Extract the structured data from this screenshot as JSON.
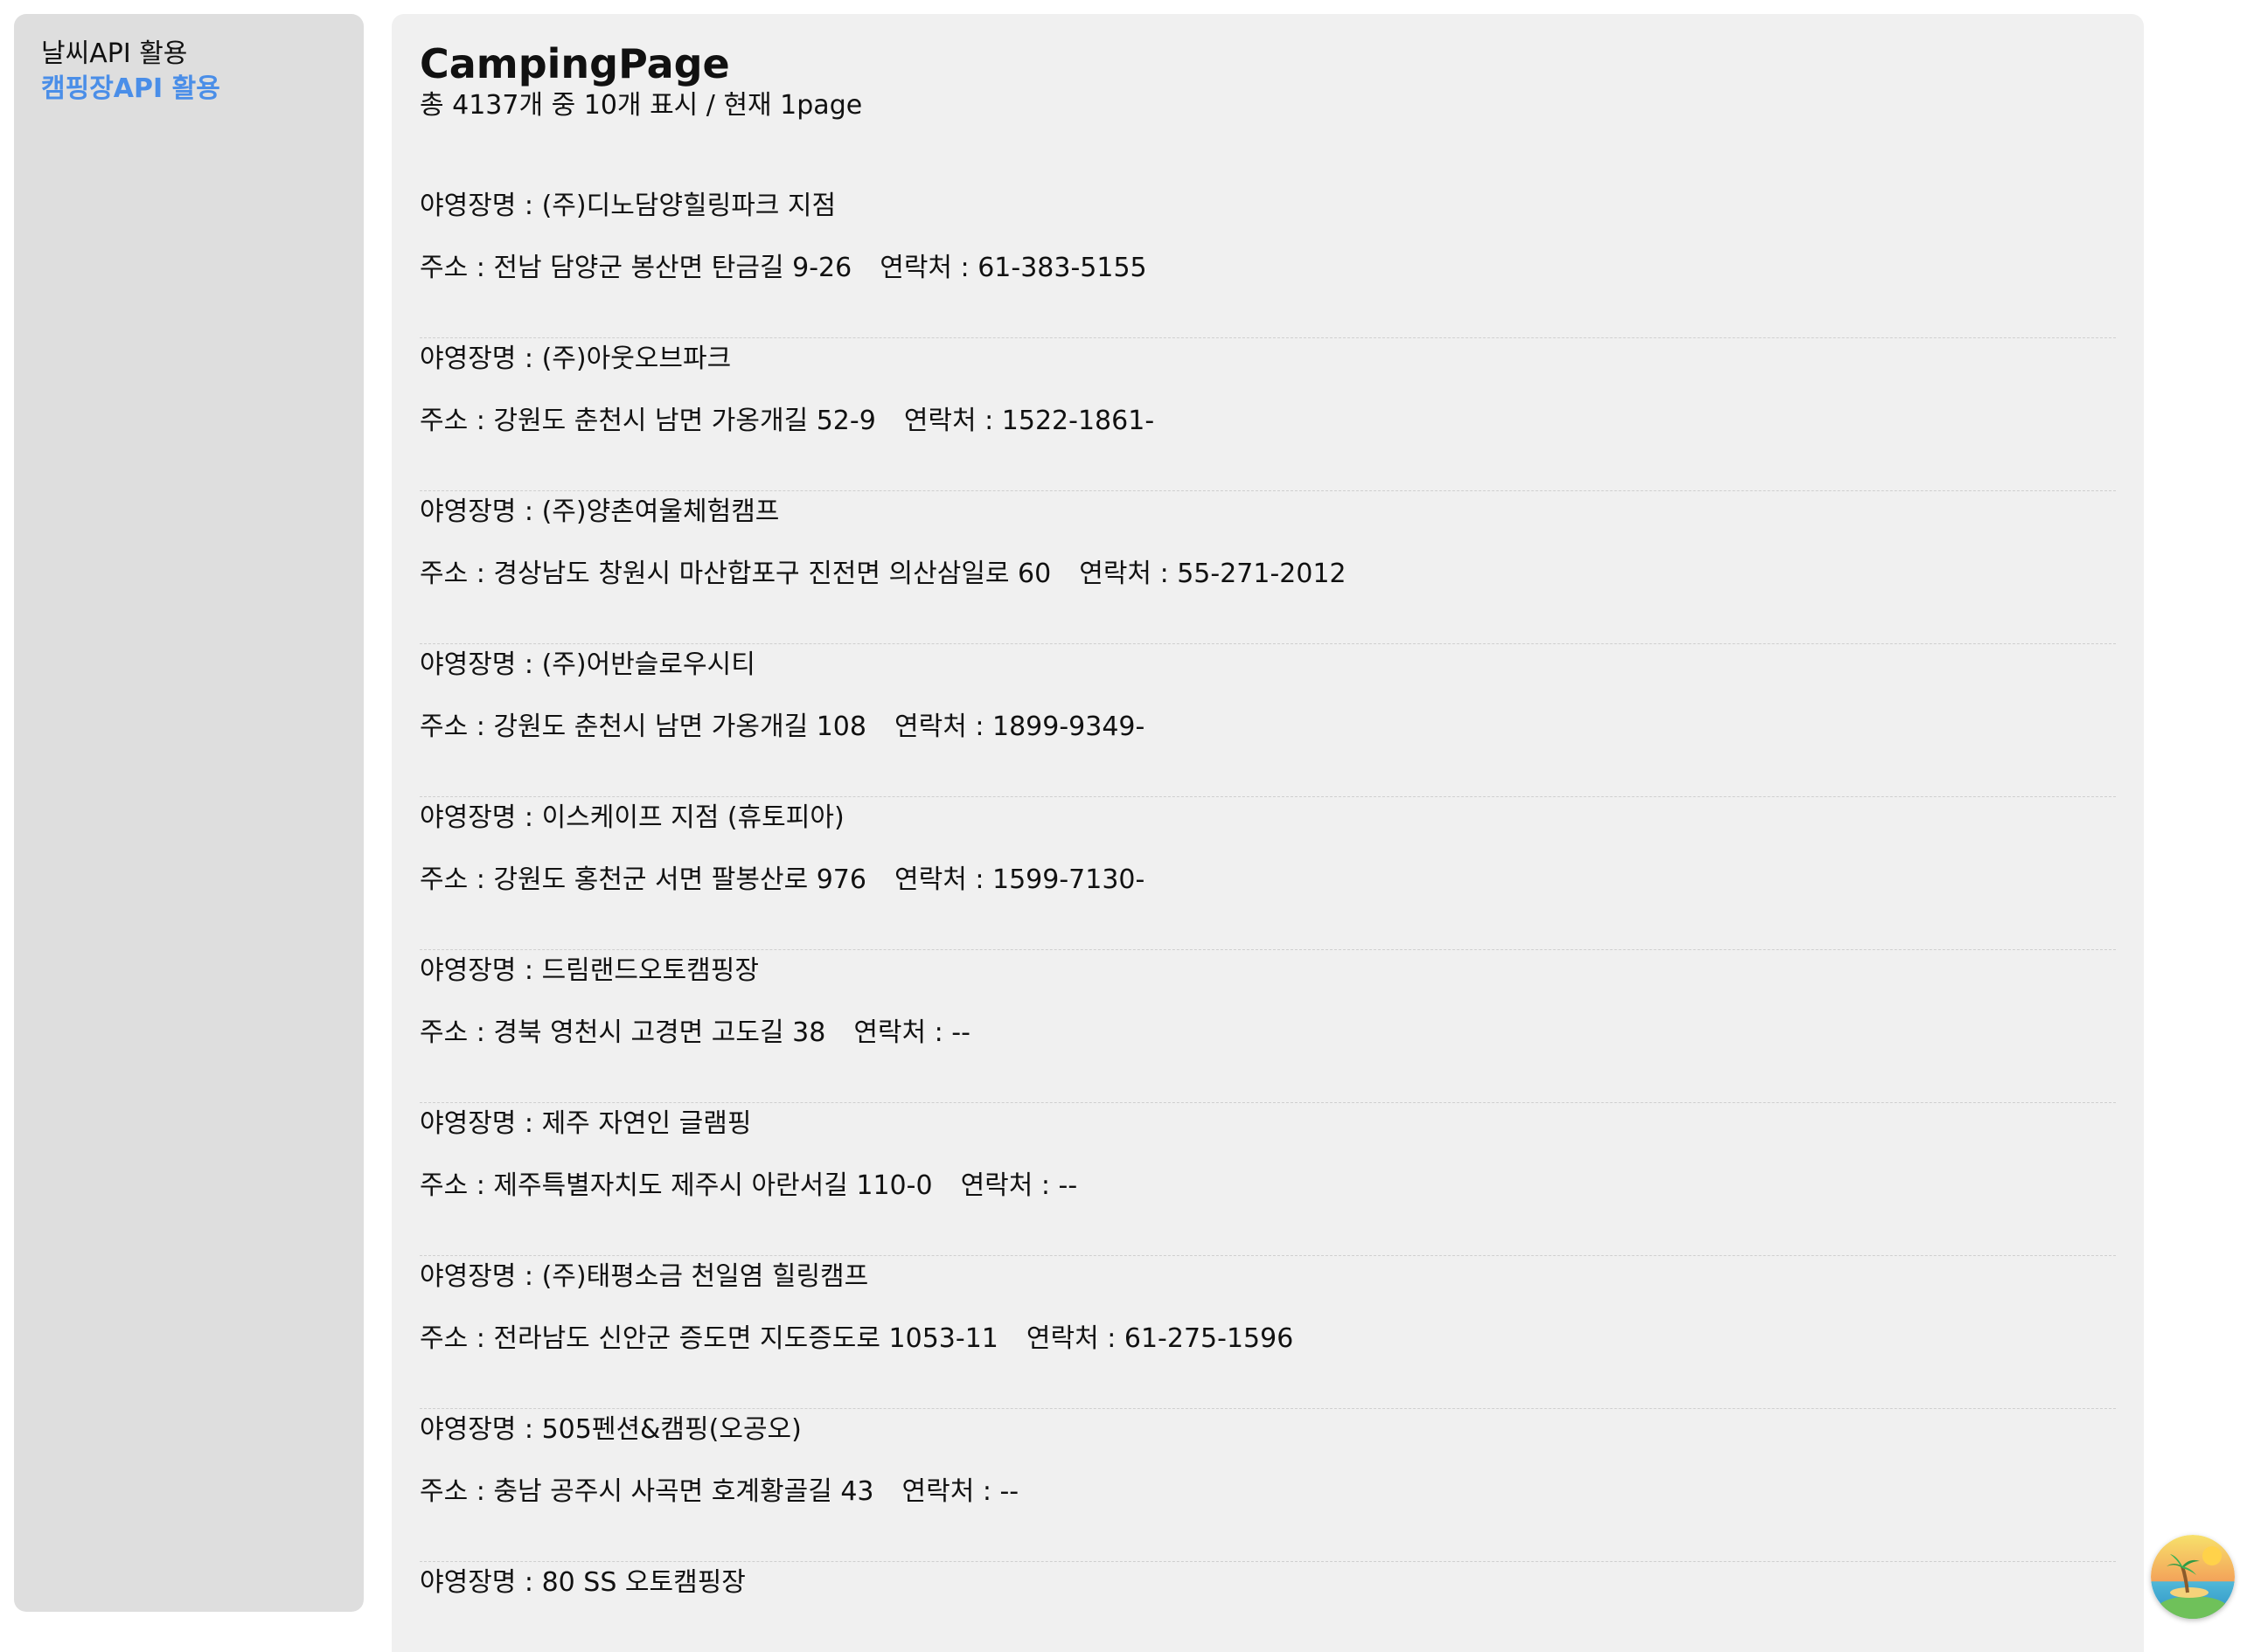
{
  "sidebar": {
    "items": [
      {
        "label": "날씨API 활용",
        "active": false
      },
      {
        "label": "캠핑장API 활용",
        "active": true
      }
    ]
  },
  "main": {
    "title": "CampingPage",
    "summary": "총 4137개 중 10개 표시 / 현재 1page"
  },
  "camps": [
    {
      "name": "야영장명 : (주)디노담양힐링파크 지점",
      "address": "주소 : 전남 담양군 봉산면 탄금길 9-26",
      "phone": "연락처 : 61-383-5155"
    },
    {
      "name": "야영장명 : (주)아웃오브파크",
      "address": "주소 : 강원도 춘천시 남면 가옹개길 52-9",
      "phone": "연락처 : 1522-1861-"
    },
    {
      "name": "야영장명 : (주)양촌여울체험캠프",
      "address": "주소 : 경상남도 창원시 마산합포구 진전면 의산삼일로 60",
      "phone": "연락처 : 55-271-2012"
    },
    {
      "name": "야영장명 : (주)어반슬로우시티",
      "address": "주소 : 강원도 춘천시 남면 가옹개길 108",
      "phone": "연락처 : 1899-9349-"
    },
    {
      "name": "야영장명 : 이스케이프 지점 (휴토피아)",
      "address": "주소 : 강원도 홍천군 서면 팔봉산로 976",
      "phone": "연락처 : 1599-7130-"
    },
    {
      "name": "야영장명 : 드림랜드오토캠핑장",
      "address": "주소 : 경북 영천시 고경면 고도길 38",
      "phone": "연락처 : --"
    },
    {
      "name": "야영장명 : 제주 자연인 글램핑",
      "address": "주소 : 제주특별자치도 제주시 아란서길 110-0",
      "phone": "연락처 : --"
    },
    {
      "name": "야영장명 : (주)태평소금 천일염 힐링캠프",
      "address": "주소 : 전라남도 신안군 증도면 지도증도로 1053-11",
      "phone": "연락처 : 61-275-1596"
    },
    {
      "name": "야영장명 : 505펜션&캠핑(오공오)",
      "address": "주소 : 충남 공주시 사곡면 호계황골길 43",
      "phone": "연락처 : --"
    },
    {
      "name": "야영장명 : 80 SS 오토캠핑장",
      "address": "",
      "phone": ""
    }
  ],
  "fab": {
    "icon": "island-palm-sunset-icon"
  }
}
